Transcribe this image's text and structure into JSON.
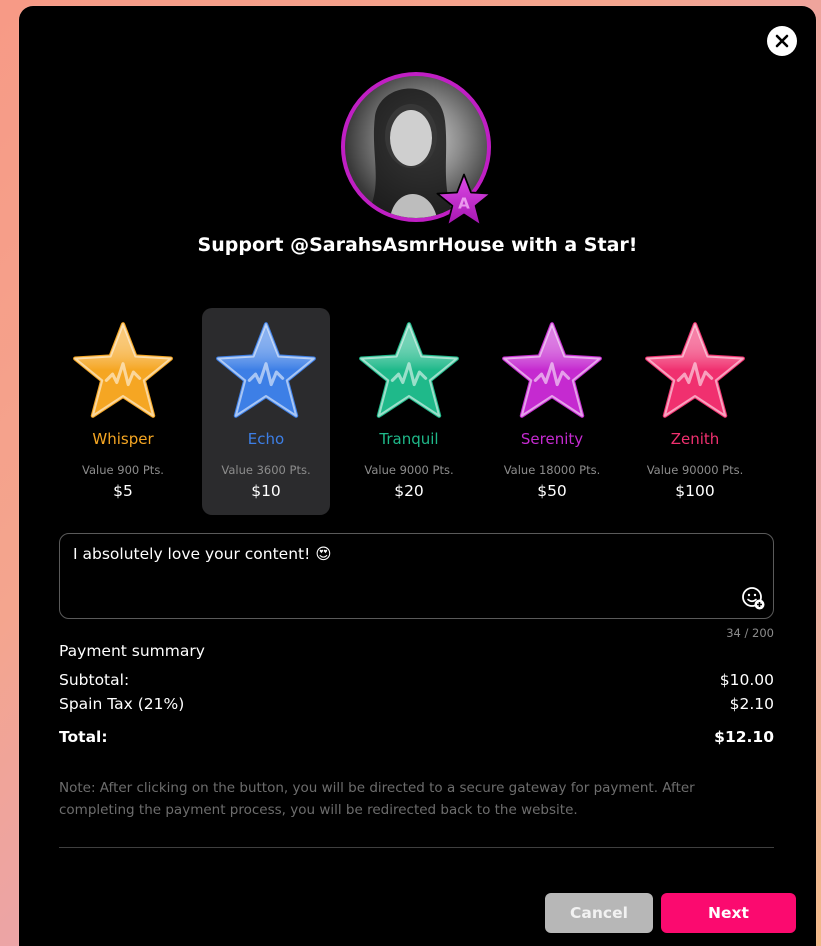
{
  "modal": {
    "title": "Support @SarahsAsmrHouse with a Star!"
  },
  "colors": {
    "avatar_ring": "#c01fc4",
    "next_button": "#fb0a6f",
    "cancel_button": "#b7b7b7",
    "selected_tier_bg": "#2b2b2d"
  },
  "tiers": [
    {
      "name": "Whisper",
      "points": "Value 900 Pts.",
      "price": "$5",
      "color": "#f5a623",
      "selected": false
    },
    {
      "name": "Echo",
      "points": "Value 3600 Pts.",
      "price": "$10",
      "color": "#3d7fe6",
      "selected": true
    },
    {
      "name": "Tranquil",
      "points": "Value 9000 Pts.",
      "price": "$20",
      "color": "#1fb98a",
      "selected": false
    },
    {
      "name": "Serenity",
      "points": "Value 18000 Pts.",
      "price": "$50",
      "color": "#c52ad0",
      "selected": false
    },
    {
      "name": "Zenith",
      "points": "Value 90000 Pts.",
      "price": "$100",
      "color": "#f0306f",
      "selected": false
    }
  ],
  "message": {
    "value": "I absolutely love your content! 😍",
    "counter": "34 / 200",
    "emoji_icon": "add-emoji-icon"
  },
  "summary": {
    "heading": "Payment summary",
    "subtotal_label": "Subtotal:",
    "subtotal_value": "$10.00",
    "tax_label": "Spain Tax (21%)",
    "tax_value": "$2.10",
    "total_label": "Total:",
    "total_value": "$12.10"
  },
  "note": "Note: After clicking on the button, you will be directed to a secure gateway for payment. After completing the payment process, you will be redirected back to the website.",
  "buttons": {
    "cancel": "Cancel",
    "next": "Next"
  }
}
